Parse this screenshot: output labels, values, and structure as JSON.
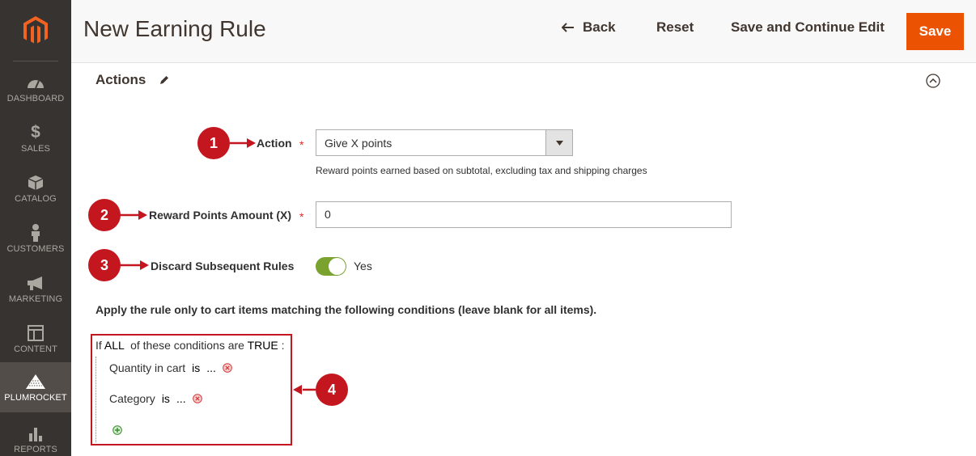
{
  "sidebar": {
    "items": [
      {
        "label": "DASHBOARD",
        "icon": "dashboard-icon"
      },
      {
        "label": "SALES",
        "icon": "dollar-icon"
      },
      {
        "label": "CATALOG",
        "icon": "box-icon"
      },
      {
        "label": "CUSTOMERS",
        "icon": "person-icon"
      },
      {
        "label": "MARKETING",
        "icon": "megaphone-icon"
      },
      {
        "label": "CONTENT",
        "icon": "layout-icon"
      },
      {
        "label": "PLUMROCKET",
        "icon": "plumrocket-icon"
      },
      {
        "label": "REPORTS",
        "icon": "bar-chart-icon"
      }
    ],
    "active": "PLUMROCKET"
  },
  "header": {
    "title": "New Earning Rule",
    "back_label": "Back",
    "reset_label": "Reset",
    "save_continue_label": "Save and Continue Edit",
    "save_label": "Save"
  },
  "section": {
    "title": "Actions"
  },
  "form": {
    "action_label": "Action",
    "action_value": "Give X points",
    "action_note": "Reward points earned based on subtotal, excluding tax and shipping charges",
    "amount_label": "Reward Points Amount (X)",
    "amount_value": "0",
    "discard_label": "Discard Subsequent Rules",
    "discard_value": "Yes",
    "required_mark": "*"
  },
  "conditions": {
    "intro": "Apply the rule only to cart items matching the following conditions (leave blank for all items).",
    "head_if": "If",
    "head_all": "ALL",
    "head_mid": "of these conditions are",
    "head_true": "TRUE",
    "head_colon": ":",
    "rows": [
      {
        "attribute": "Quantity in cart",
        "operator": "is",
        "value": "..."
      },
      {
        "attribute": "Category",
        "operator": "is",
        "value": "..."
      }
    ]
  },
  "callouts": [
    "1",
    "2",
    "3",
    "4"
  ],
  "colors": {
    "sidebar_bg": "#373330",
    "accent": "#eb5202",
    "callout": "#c3161e",
    "toggle_on": "#79a22e"
  }
}
